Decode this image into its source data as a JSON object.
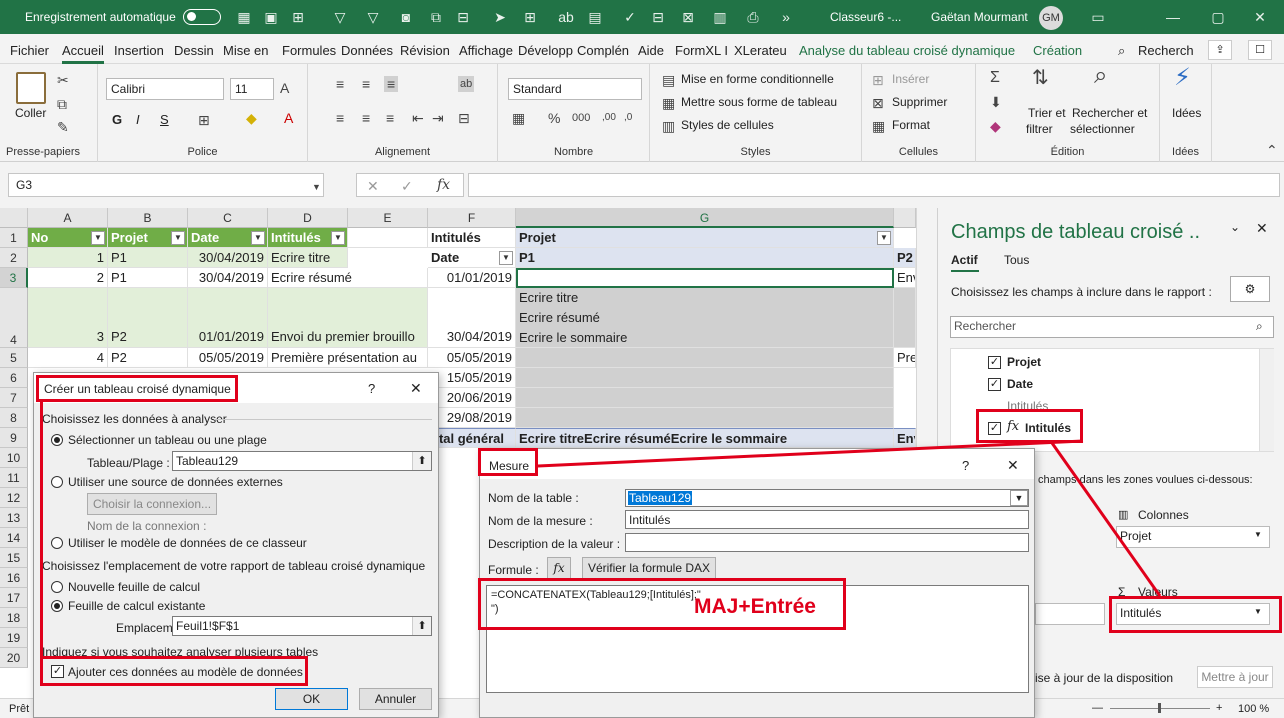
{
  "titlebar": {
    "autosave": "Enregistrement automatique",
    "filename": "Classeur6 -...",
    "user": "Gaëtan Mourmant",
    "initials": "GM"
  },
  "tabs": [
    "Fichier",
    "Accueil",
    "Insertion",
    "Dessin",
    "Mise en",
    "Formules",
    "Données",
    "Révision",
    "Affichage",
    "Développ",
    "Complén",
    "Aide",
    "FormXL I",
    "XLerateu",
    "Analyse du tableau croisé dynamique",
    "Création"
  ],
  "search_tab": "Recherch",
  "ribbon": {
    "paste": "Coller",
    "clipboard": "Presse-papiers",
    "font_name": "Calibri",
    "font_size": "11",
    "font": "Police",
    "bold": "G",
    "italic": "I",
    "underline": "S",
    "alignment": "Alignement",
    "number_format": "Standard",
    "number": "Nombre",
    "cond_format": "Mise en forme conditionnelle",
    "table_format": "Mettre sous forme de tableau",
    "cell_styles": "Styles de cellules",
    "styles": "Styles",
    "insert": "Insérer",
    "delete": "Supprimer",
    "format": "Format",
    "cells": "Cellules",
    "sort_filter_1": "Trier et",
    "sort_filter_2": "filtrer",
    "find_1": "Rechercher et",
    "find_2": "sélectionner",
    "editing": "Édition",
    "ideas": "Idées",
    "ideas_group": "Idées"
  },
  "namebox": "G3",
  "columns": [
    "A",
    "B",
    "C",
    "D",
    "E",
    "F",
    "G"
  ],
  "rows": [
    "1",
    "2",
    "3",
    "4",
    "5",
    "6",
    "7",
    "8",
    "9",
    "10",
    "11",
    "12",
    "13",
    "14",
    "15",
    "16",
    "17",
    "18",
    "19",
    "20"
  ],
  "sheet": {
    "h_no": "No",
    "h_projet": "Projet",
    "h_date": "Date",
    "h_intitules": "Intitulés",
    "r2": [
      "1",
      "P1",
      "30/04/2019",
      "Ecrire titre"
    ],
    "r3": [
      "2",
      "P1",
      "30/04/2019",
      "Ecrire résumé"
    ],
    "r4": [
      "3",
      "P2",
      "01/01/2019",
      "Envoi du premier brouillo"
    ],
    "r5": [
      "4",
      "P2",
      "05/05/2019",
      "Première présentation au"
    ],
    "f1": "Intitulés",
    "f2": "Date",
    "f3": "01/01/2019",
    "f4": "30/04/2019",
    "f5": "05/05/2019",
    "f6": "15/05/2019",
    "f7": "20/06/2019",
    "f8": "29/08/2019",
    "f9": "otal général",
    "g1": "Projet",
    "g2": "P1",
    "p2": "P2",
    "g4a": "Ecrire titre",
    "g4b": "Ecrire résumé",
    "g4c": "Ecrire le sommaire",
    "g9": "Ecrire titreEcrire résuméEcrire le sommaire",
    "env": "Env",
    "pre": "Pre"
  },
  "pane": {
    "title": "Champs de tableau croisé ..",
    "tab_active": "Actif",
    "tab_all": "Tous",
    "choose": "Choisissez les champs à inclure dans le rapport :",
    "search": "Rechercher",
    "fields": [
      "Projet",
      "Date",
      "Intitulés"
    ],
    "measure_field": "Intitulés",
    "drag_text": "champs dans les zones voulues ci-dessous:",
    "columns_label": "Colonnes",
    "columns_value": "Projet",
    "values_label": "Valeurs",
    "values_value": "Intitulés",
    "defer": "ise à jour de la disposition",
    "update": "Mettre à jour"
  },
  "status": {
    "ready": "Prêt",
    "zoom": "100 %"
  },
  "create_dialog": {
    "title": "Créer un tableau croisé dynamique",
    "help": "?",
    "choose_data": "Choisissez les données à analyser",
    "select_table": "Sélectionner un tableau ou une plage",
    "table_range_label": "Tableau/Plage :",
    "table_range": "Tableau129",
    "external": "Utiliser une source de données externes",
    "choose_conn": "Choisir la connexion...",
    "conn_name": "Nom de la connexion :",
    "data_model": "Utiliser le modèle de données de ce classeur",
    "choose_loc": "Choisissez l'emplacement de votre rapport de tableau croisé dynamique",
    "new_sheet": "Nouvelle feuille de calcul",
    "existing_sheet": "Feuille de calcul existante",
    "location_label": "Emplacement :",
    "location": "Feuil1!$F$1",
    "multi": "Indiquez si vous souhaitez analyser plusieurs tables",
    "add_model": "Ajouter ces données au modèle de données",
    "ok": "OK",
    "cancel": "Annuler"
  },
  "measure_dialog": {
    "title": "Mesure",
    "help": "?",
    "table_label": "Nom de la table :",
    "table_value": "Tableau129",
    "measure_label": "Nom de la mesure :",
    "measure_value": "Intitulés",
    "desc_label": "Description de la valeur :",
    "formula_label": "Formule :",
    "fx": "fx",
    "check_dax": "Vérifier la formule DAX",
    "formula_line1": "=CONCATENATEX(Tableau129;[Intitulés];\"",
    "formula_line2": "\")",
    "annotation": "MAJ+Entrée"
  }
}
